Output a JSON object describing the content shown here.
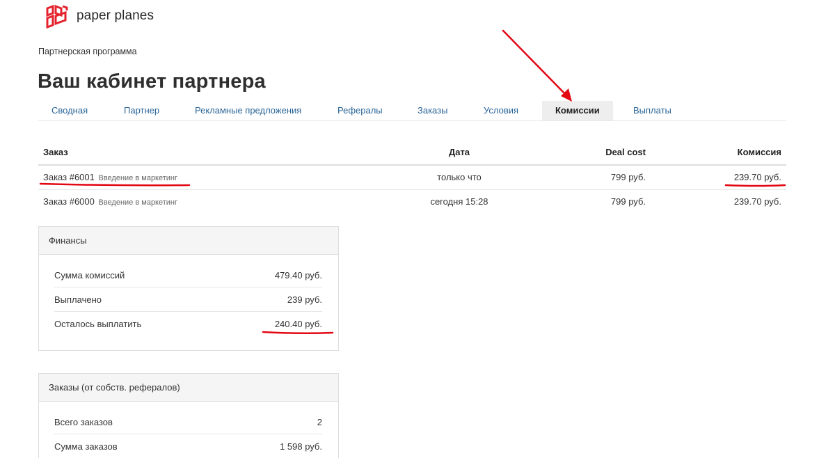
{
  "brand": {
    "name": "paper planes",
    "color": "#e4232f",
    "icon": "paper-planes-logo"
  },
  "breadcrumb": "Партнерская программа",
  "page_title": "Ваш кабинет партнера",
  "tabs": [
    {
      "label": "Сводная",
      "active": false
    },
    {
      "label": "Партнер",
      "active": false
    },
    {
      "label": "Рекламные предложения",
      "active": false
    },
    {
      "label": "Рефералы",
      "active": false
    },
    {
      "label": "Заказы",
      "active": false
    },
    {
      "label": "Условия",
      "active": false
    },
    {
      "label": "Комиссии",
      "active": true
    },
    {
      "label": "Выплаты",
      "active": false
    }
  ],
  "orders_table": {
    "headers": {
      "order": "Заказ",
      "date": "Дата",
      "deal_cost": "Deal cost",
      "commission": "Комиссия"
    },
    "rows": [
      {
        "order": "Заказ #6001",
        "course": "Введение в маркетинг",
        "date": "только что",
        "deal_cost": "799 руб.",
        "commission": "239.70 руб."
      },
      {
        "order": "Заказ #6000",
        "course": "Введение в маркетинг",
        "date": "сегодня 15:28",
        "deal_cost": "799 руб.",
        "commission": "239.70 руб."
      }
    ]
  },
  "finance_panel": {
    "title": "Финансы",
    "rows": [
      {
        "label": "Сумма комиссий",
        "value": "479.40 руб."
      },
      {
        "label": "Выплачено",
        "value": "239 руб."
      },
      {
        "label": "Осталось выплатить",
        "value": "240.40 руб."
      }
    ]
  },
  "referral_orders_panel": {
    "title": "Заказы (от собств. рефералов)",
    "rows": [
      {
        "label": "Всего заказов",
        "value": "2"
      },
      {
        "label": "Сумма заказов",
        "value": "1 598 руб."
      }
    ]
  },
  "annotation": {
    "color": "#e30613"
  }
}
